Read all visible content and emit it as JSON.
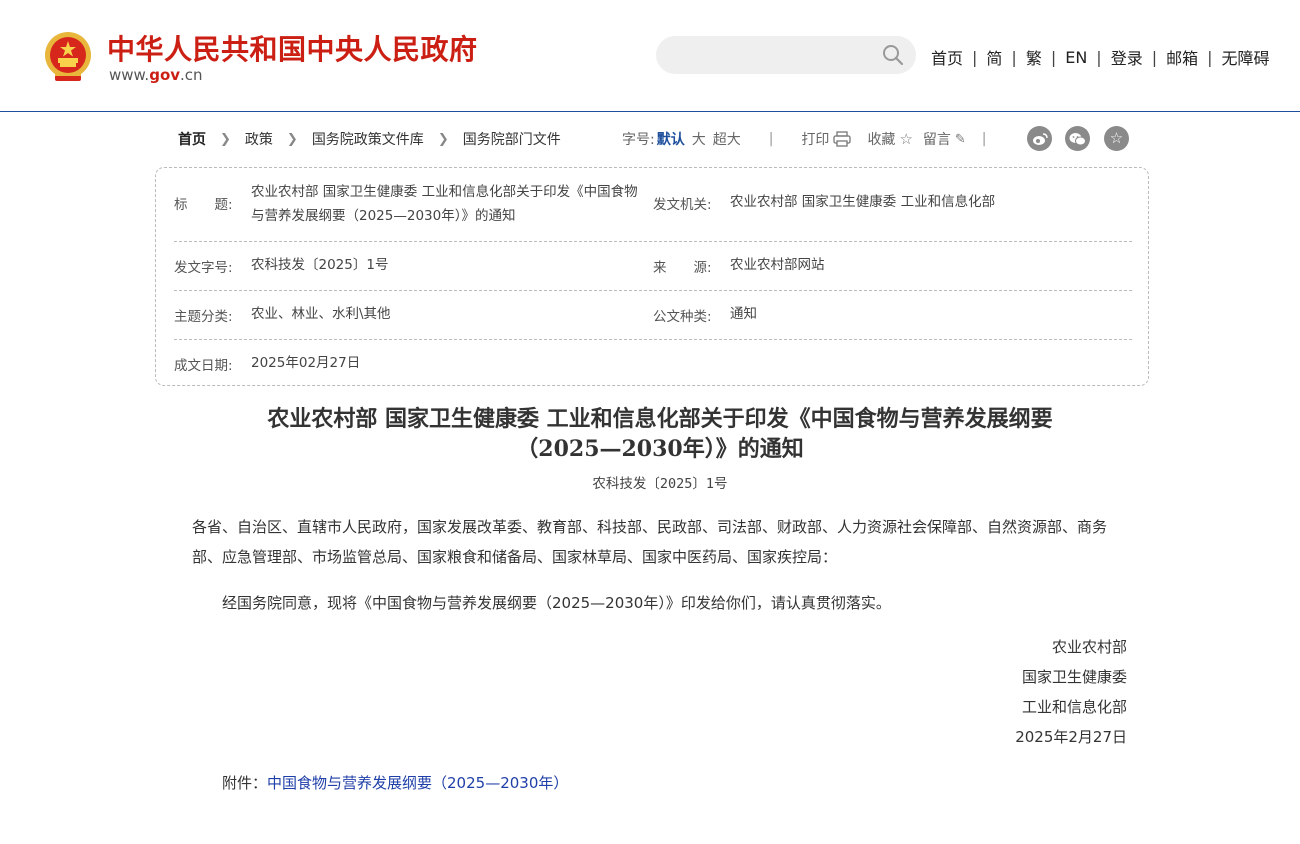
{
  "header": {
    "site_title": "中华人民共和国中央人民政府",
    "site_url_prefix": "www.",
    "site_url_domain": "gov",
    "site_url_suffix": ".cn",
    "search_placeholder": "",
    "search_icon": "search-icon",
    "nav": [
      "首页",
      "简",
      "繁",
      "EN",
      "登录",
      "邮箱",
      "无障碍"
    ]
  },
  "toolbar": {
    "breadcrumbs": [
      "首页",
      "政策",
      "国务院政策文件库",
      "国务院部门文件"
    ],
    "font_size_label": "字号:",
    "font_sizes": [
      "默认",
      "大",
      "超大"
    ],
    "print_label": "打印",
    "favorite_label": "收藏",
    "comment_label": "留言",
    "share_icons": [
      "weibo-icon",
      "wechat-icon",
      "star-icon"
    ]
  },
  "info": {
    "title_label": "标　　题:",
    "title_value": "农业农村部 国家卫生健康委 工业和信息化部关于印发《中国食物与营养发展纲要（2025—2030年）》的通知",
    "issuer_label": "发文机关:",
    "issuer_value": "农业农村部 国家卫生健康委 工业和信息化部",
    "doc_no_label": "发文字号:",
    "doc_no_value": "农科技发〔2025〕1号",
    "source_label": "来　　源:",
    "source_value": "农业农村部网站",
    "topic_label": "主题分类:",
    "topic_value": "农业、林业、水利\\其他",
    "type_label": "公文种类:",
    "type_value": "通知",
    "date_label": "成文日期:",
    "date_value": "2025年02月27日"
  },
  "document": {
    "title_line1": "农业农村部 国家卫生健康委 工业和信息化部关于印发《中国食物与营养发展纲要",
    "title_line2": "（2025—2030年）》的通知",
    "number": "农科技发〔2025〕1号",
    "recipients": "各省、自治区、直辖市人民政府，国家发展改革委、教育部、科技部、民政部、司法部、财政部、人力资源社会保障部、自然资源部、商务部、应急管理部、市场监管总局、国家粮食和储备局、国家林草局、国家中医药局、国家疾控局：",
    "body": "经国务院同意，现将《中国食物与营养发展纲要（2025—2030年）》印发给你们，请认真贯彻落实。",
    "signatories": [
      "农业农村部",
      "国家卫生健康委",
      "工业和信息化部"
    ],
    "sign_date": "2025年2月27日",
    "attachment_label": "附件：",
    "attachment_link": "中国食物与营养发展纲要（2025—2030年）"
  },
  "colors": {
    "brand_red": "#cc1f14",
    "nav_blue": "#1f4f9c",
    "link_blue": "#1f3fa8"
  }
}
